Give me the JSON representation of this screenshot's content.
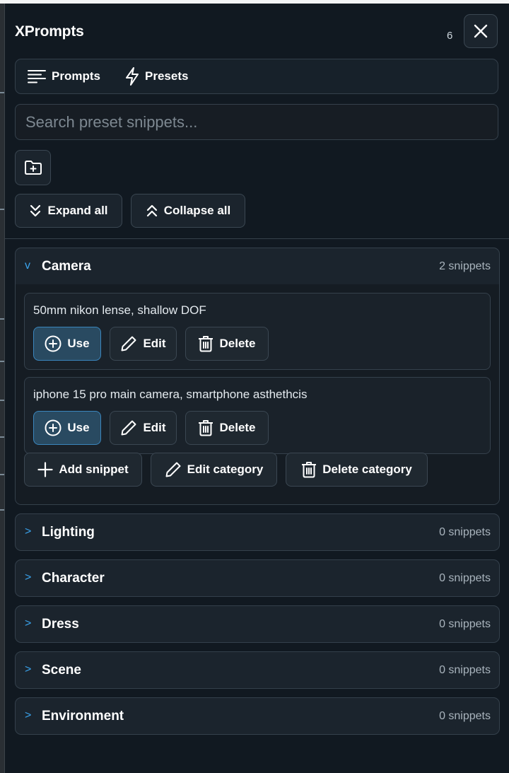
{
  "panel": {
    "title": "XPrompts",
    "count": "6"
  },
  "tabs": [
    {
      "label": "Prompts",
      "icon": "list-lines-icon"
    },
    {
      "label": "Presets",
      "icon": "lightning-icon"
    }
  ],
  "search": {
    "placeholder": "Search preset snippets..."
  },
  "toolbar": {
    "expand_all": "Expand all",
    "collapse_all": "Collapse all"
  },
  "categories": [
    {
      "name": "Camera",
      "count": "2 snippets",
      "expanded": true,
      "chevron": "v",
      "snippets": [
        {
          "text": "50mm nikon lense, shallow DOF"
        },
        {
          "text": "iphone 15 pro main camera, smartphone asthethcis"
        }
      ]
    },
    {
      "name": "Lighting",
      "count": "0 snippets",
      "expanded": false,
      "chevron": ">"
    },
    {
      "name": "Character",
      "count": "0 snippets",
      "expanded": false,
      "chevron": ">"
    },
    {
      "name": "Dress",
      "count": "0 snippets",
      "expanded": false,
      "chevron": ">"
    },
    {
      "name": "Scene",
      "count": "0 snippets",
      "expanded": false,
      "chevron": ">"
    },
    {
      "name": "Environment",
      "count": "0 snippets",
      "expanded": false,
      "chevron": ">"
    }
  ],
  "snippet_actions": {
    "use": "Use",
    "edit": "Edit",
    "delete": "Delete"
  },
  "category_actions": {
    "add_snippet": "Add snippet",
    "edit_category": "Edit category",
    "delete_category": "Delete category"
  },
  "colors": {
    "accent": "#3aa3ec",
    "use_button": "#294a61",
    "panel_bg": "#111921"
  }
}
